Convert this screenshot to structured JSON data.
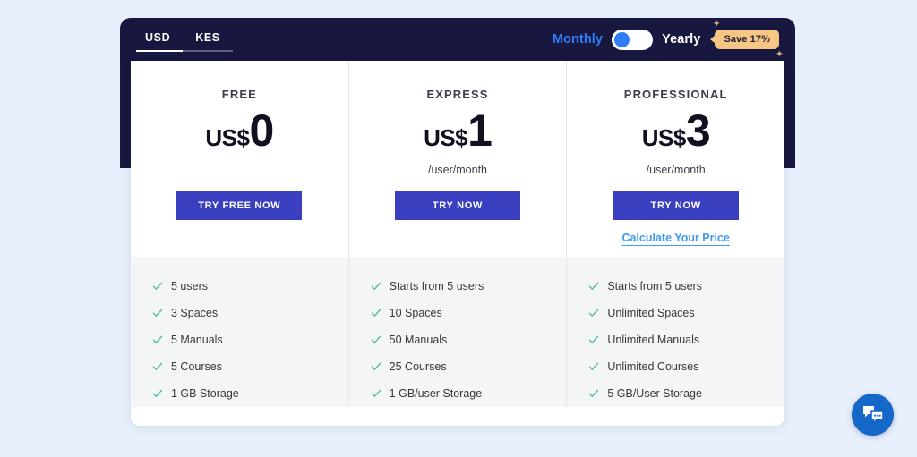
{
  "header": {
    "currency_tabs": [
      {
        "label": "USD",
        "active": true
      },
      {
        "label": "KES",
        "active": false
      }
    ],
    "billing": {
      "monthly_label": "Monthly",
      "yearly_label": "Yearly",
      "selected": "Monthly",
      "save_badge": "Save 17%"
    },
    "colors": {
      "panel": "#17173f",
      "accent_blue": "#2f7df6",
      "badge": "#f6c685"
    }
  },
  "plans": [
    {
      "name": "FREE",
      "currency": "US$",
      "amount": "0",
      "period": "",
      "cta": "TRY FREE NOW",
      "link": "",
      "features": [
        "5 users",
        "3 Spaces",
        "5 Manuals",
        "5 Courses",
        "1 GB Storage"
      ]
    },
    {
      "name": "EXPRESS",
      "currency": "US$",
      "amount": "1",
      "period": "/user/month",
      "cta": "TRY NOW",
      "link": "",
      "features": [
        "Starts from 5 users",
        "10 Spaces",
        "50 Manuals",
        "25 Courses",
        "1 GB/user Storage"
      ]
    },
    {
      "name": "PROFESSIONAL",
      "currency": "US$",
      "amount": "3",
      "period": "/user/month",
      "cta": "TRY NOW",
      "link": "Calculate Your Price",
      "features": [
        "Starts from 5 users",
        "Unlimited Spaces",
        "Unlimited Manuals",
        "Unlimited Courses",
        "5 GB/User Storage"
      ]
    }
  ],
  "widgets": {
    "chat": "chat-bubbles-icon"
  },
  "theme": {
    "page_background": "#e7effc",
    "button_blue": "#3a3fc0",
    "check_green": "#4fbf87",
    "link_blue": "#3f9bf0",
    "feature_background": "#f4f5f6"
  }
}
